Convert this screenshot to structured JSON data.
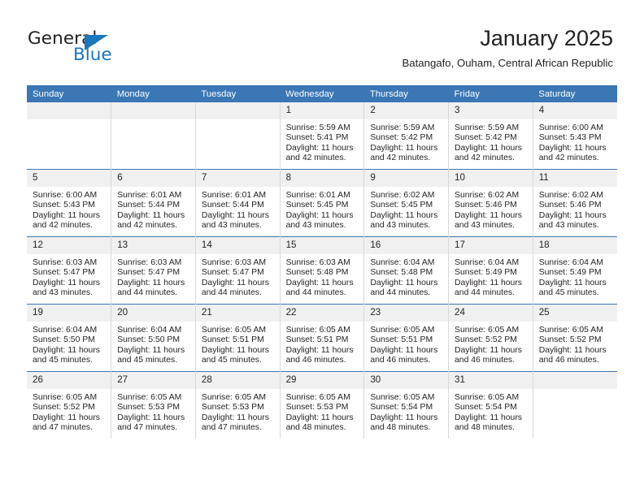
{
  "brand": {
    "name_part1": "General",
    "name_part2": "Blue",
    "accent_color": "#1b76bc"
  },
  "header": {
    "month_title": "January 2025",
    "location": "Batangafo, Ouham, Central African Republic"
  },
  "theme": {
    "header_row_bg": "#3b76b5",
    "daynum_bg": "#f0f0f0",
    "grid_line": "#d8d8d8",
    "text": "#231f20"
  },
  "columns": [
    "Sunday",
    "Monday",
    "Tuesday",
    "Wednesday",
    "Thursday",
    "Friday",
    "Saturday"
  ],
  "weeks": [
    [
      {
        "day": "",
        "sunrise": "",
        "sunset": "",
        "daylight1": "",
        "daylight2": "",
        "empty": true
      },
      {
        "day": "",
        "sunrise": "",
        "sunset": "",
        "daylight1": "",
        "daylight2": "",
        "empty": true
      },
      {
        "day": "",
        "sunrise": "",
        "sunset": "",
        "daylight1": "",
        "daylight2": "",
        "empty": true
      },
      {
        "day": "1",
        "sunrise": "Sunrise: 5:59 AM",
        "sunset": "Sunset: 5:41 PM",
        "daylight1": "Daylight: 11 hours",
        "daylight2": "and 42 minutes."
      },
      {
        "day": "2",
        "sunrise": "Sunrise: 5:59 AM",
        "sunset": "Sunset: 5:42 PM",
        "daylight1": "Daylight: 11 hours",
        "daylight2": "and 42 minutes."
      },
      {
        "day": "3",
        "sunrise": "Sunrise: 5:59 AM",
        "sunset": "Sunset: 5:42 PM",
        "daylight1": "Daylight: 11 hours",
        "daylight2": "and 42 minutes."
      },
      {
        "day": "4",
        "sunrise": "Sunrise: 6:00 AM",
        "sunset": "Sunset: 5:43 PM",
        "daylight1": "Daylight: 11 hours",
        "daylight2": "and 42 minutes."
      }
    ],
    [
      {
        "day": "5",
        "sunrise": "Sunrise: 6:00 AM",
        "sunset": "Sunset: 5:43 PM",
        "daylight1": "Daylight: 11 hours",
        "daylight2": "and 42 minutes."
      },
      {
        "day": "6",
        "sunrise": "Sunrise: 6:01 AM",
        "sunset": "Sunset: 5:44 PM",
        "daylight1": "Daylight: 11 hours",
        "daylight2": "and 42 minutes."
      },
      {
        "day": "7",
        "sunrise": "Sunrise: 6:01 AM",
        "sunset": "Sunset: 5:44 PM",
        "daylight1": "Daylight: 11 hours",
        "daylight2": "and 43 minutes."
      },
      {
        "day": "8",
        "sunrise": "Sunrise: 6:01 AM",
        "sunset": "Sunset: 5:45 PM",
        "daylight1": "Daylight: 11 hours",
        "daylight2": "and 43 minutes."
      },
      {
        "day": "9",
        "sunrise": "Sunrise: 6:02 AM",
        "sunset": "Sunset: 5:45 PM",
        "daylight1": "Daylight: 11 hours",
        "daylight2": "and 43 minutes."
      },
      {
        "day": "10",
        "sunrise": "Sunrise: 6:02 AM",
        "sunset": "Sunset: 5:46 PM",
        "daylight1": "Daylight: 11 hours",
        "daylight2": "and 43 minutes."
      },
      {
        "day": "11",
        "sunrise": "Sunrise: 6:02 AM",
        "sunset": "Sunset: 5:46 PM",
        "daylight1": "Daylight: 11 hours",
        "daylight2": "and 43 minutes."
      }
    ],
    [
      {
        "day": "12",
        "sunrise": "Sunrise: 6:03 AM",
        "sunset": "Sunset: 5:47 PM",
        "daylight1": "Daylight: 11 hours",
        "daylight2": "and 43 minutes."
      },
      {
        "day": "13",
        "sunrise": "Sunrise: 6:03 AM",
        "sunset": "Sunset: 5:47 PM",
        "daylight1": "Daylight: 11 hours",
        "daylight2": "and 44 minutes."
      },
      {
        "day": "14",
        "sunrise": "Sunrise: 6:03 AM",
        "sunset": "Sunset: 5:47 PM",
        "daylight1": "Daylight: 11 hours",
        "daylight2": "and 44 minutes."
      },
      {
        "day": "15",
        "sunrise": "Sunrise: 6:03 AM",
        "sunset": "Sunset: 5:48 PM",
        "daylight1": "Daylight: 11 hours",
        "daylight2": "and 44 minutes."
      },
      {
        "day": "16",
        "sunrise": "Sunrise: 6:04 AM",
        "sunset": "Sunset: 5:48 PM",
        "daylight1": "Daylight: 11 hours",
        "daylight2": "and 44 minutes."
      },
      {
        "day": "17",
        "sunrise": "Sunrise: 6:04 AM",
        "sunset": "Sunset: 5:49 PM",
        "daylight1": "Daylight: 11 hours",
        "daylight2": "and 44 minutes."
      },
      {
        "day": "18",
        "sunrise": "Sunrise: 6:04 AM",
        "sunset": "Sunset: 5:49 PM",
        "daylight1": "Daylight: 11 hours",
        "daylight2": "and 45 minutes."
      }
    ],
    [
      {
        "day": "19",
        "sunrise": "Sunrise: 6:04 AM",
        "sunset": "Sunset: 5:50 PM",
        "daylight1": "Daylight: 11 hours",
        "daylight2": "and 45 minutes."
      },
      {
        "day": "20",
        "sunrise": "Sunrise: 6:04 AM",
        "sunset": "Sunset: 5:50 PM",
        "daylight1": "Daylight: 11 hours",
        "daylight2": "and 45 minutes."
      },
      {
        "day": "21",
        "sunrise": "Sunrise: 6:05 AM",
        "sunset": "Sunset: 5:51 PM",
        "daylight1": "Daylight: 11 hours",
        "daylight2": "and 45 minutes."
      },
      {
        "day": "22",
        "sunrise": "Sunrise: 6:05 AM",
        "sunset": "Sunset: 5:51 PM",
        "daylight1": "Daylight: 11 hours",
        "daylight2": "and 46 minutes."
      },
      {
        "day": "23",
        "sunrise": "Sunrise: 6:05 AM",
        "sunset": "Sunset: 5:51 PM",
        "daylight1": "Daylight: 11 hours",
        "daylight2": "and 46 minutes."
      },
      {
        "day": "24",
        "sunrise": "Sunrise: 6:05 AM",
        "sunset": "Sunset: 5:52 PM",
        "daylight1": "Daylight: 11 hours",
        "daylight2": "and 46 minutes."
      },
      {
        "day": "25",
        "sunrise": "Sunrise: 6:05 AM",
        "sunset": "Sunset: 5:52 PM",
        "daylight1": "Daylight: 11 hours",
        "daylight2": "and 46 minutes."
      }
    ],
    [
      {
        "day": "26",
        "sunrise": "Sunrise: 6:05 AM",
        "sunset": "Sunset: 5:52 PM",
        "daylight1": "Daylight: 11 hours",
        "daylight2": "and 47 minutes."
      },
      {
        "day": "27",
        "sunrise": "Sunrise: 6:05 AM",
        "sunset": "Sunset: 5:53 PM",
        "daylight1": "Daylight: 11 hours",
        "daylight2": "and 47 minutes."
      },
      {
        "day": "28",
        "sunrise": "Sunrise: 6:05 AM",
        "sunset": "Sunset: 5:53 PM",
        "daylight1": "Daylight: 11 hours",
        "daylight2": "and 47 minutes."
      },
      {
        "day": "29",
        "sunrise": "Sunrise: 6:05 AM",
        "sunset": "Sunset: 5:53 PM",
        "daylight1": "Daylight: 11 hours",
        "daylight2": "and 48 minutes."
      },
      {
        "day": "30",
        "sunrise": "Sunrise: 6:05 AM",
        "sunset": "Sunset: 5:54 PM",
        "daylight1": "Daylight: 11 hours",
        "daylight2": "and 48 minutes."
      },
      {
        "day": "31",
        "sunrise": "Sunrise: 6:05 AM",
        "sunset": "Sunset: 5:54 PM",
        "daylight1": "Daylight: 11 hours",
        "daylight2": "and 48 minutes."
      },
      {
        "day": "",
        "sunrise": "",
        "sunset": "",
        "daylight1": "",
        "daylight2": "",
        "empty": true
      }
    ]
  ]
}
